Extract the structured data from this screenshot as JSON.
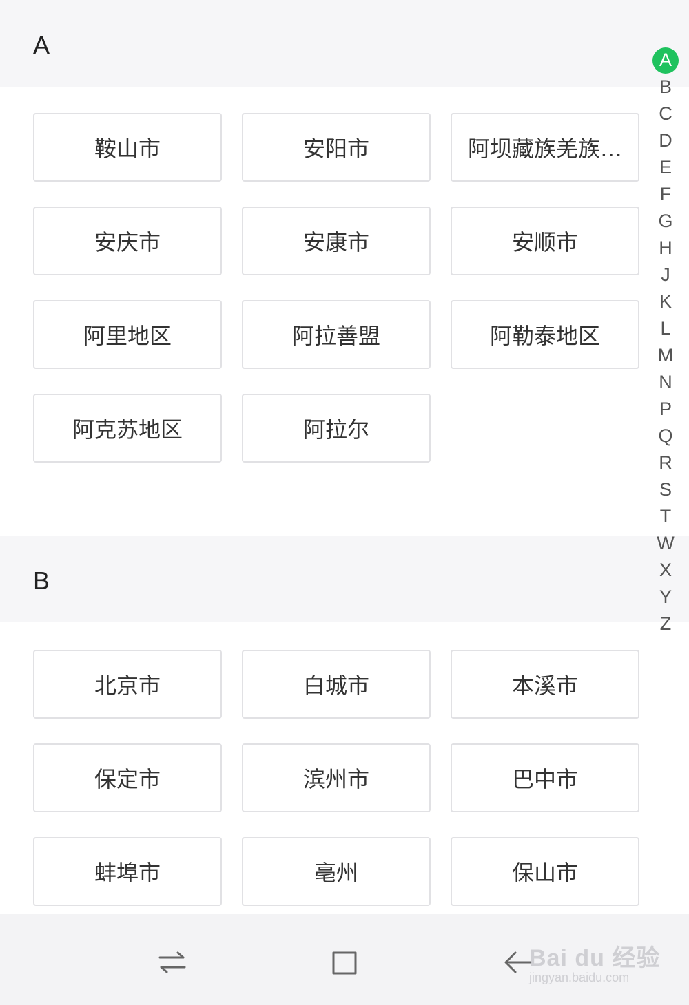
{
  "sections": [
    {
      "letter": "A",
      "cities": [
        "鞍山市",
        "安阳市",
        "阿坝藏族羌族…",
        "安庆市",
        "安康市",
        "安顺市",
        "阿里地区",
        "阿拉善盟",
        "阿勒泰地区",
        "阿克苏地区",
        "阿拉尔"
      ]
    },
    {
      "letter": "B",
      "cities": [
        "北京市",
        "白城市",
        "本溪市",
        "保定市",
        "滨州市",
        "巴中市",
        "蚌埠市",
        "亳州",
        "保山市"
      ]
    }
  ],
  "index_bar": {
    "letters": [
      "A",
      "B",
      "C",
      "D",
      "E",
      "F",
      "G",
      "H",
      "J",
      "K",
      "L",
      "M",
      "N",
      "P",
      "Q",
      "R",
      "S",
      "T",
      "W",
      "X",
      "Y",
      "Z"
    ],
    "active": "A",
    "active_color": "#1fc25e"
  },
  "nav_bar": {
    "icons": [
      "recent-apps-icon",
      "home-icon",
      "back-icon"
    ]
  },
  "watermark": {
    "main": "Bai du 经验",
    "sub": "jingyan.baidu.com"
  }
}
